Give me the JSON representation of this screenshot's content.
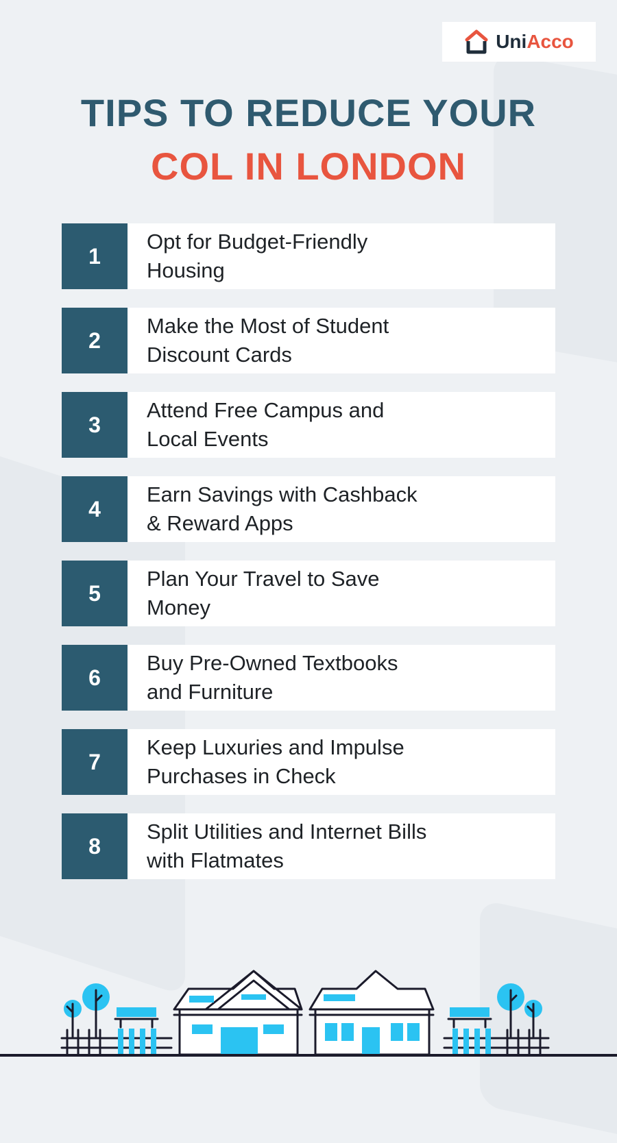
{
  "brand": {
    "name_part1": "Uni",
    "name_part2": "Acco",
    "logo_icon": "house-logo-icon",
    "colors": {
      "dark": "#1f2d3a",
      "accent": "#e8553f"
    }
  },
  "title": {
    "line1": "TIPS TO REDUCE YOUR",
    "line2": "COL IN LONDON"
  },
  "tips": [
    {
      "number": "1",
      "text": "Opt for Budget-Friendly\nHousing"
    },
    {
      "number": "2",
      "text": "Make the Most of Student\nDiscount Cards"
    },
    {
      "number": "3",
      "text": "Attend Free Campus and\nLocal Events"
    },
    {
      "number": "4",
      "text": "Earn Savings with Cashback\n& Reward Apps"
    },
    {
      "number": "5",
      "text": "Plan Your Travel to Save\nMoney"
    },
    {
      "number": "6",
      "text": "Buy Pre-Owned Textbooks\nand Furniture"
    },
    {
      "number": "7",
      "text": "Keep Luxuries and Impulse\nPurchases in Check"
    },
    {
      "number": "8",
      "text": "Split Utilities and Internet Bills\nwith Flatmates"
    }
  ],
  "colors": {
    "background": "#eef1f4",
    "number_box": "#2c5b70",
    "title_primary": "#2f5a6f",
    "title_accent": "#e8553f",
    "illustration_blue": "#2bc3f2",
    "illustration_line": "#1b1b2b"
  },
  "illustration": {
    "icon": "houses-street-illustration"
  }
}
